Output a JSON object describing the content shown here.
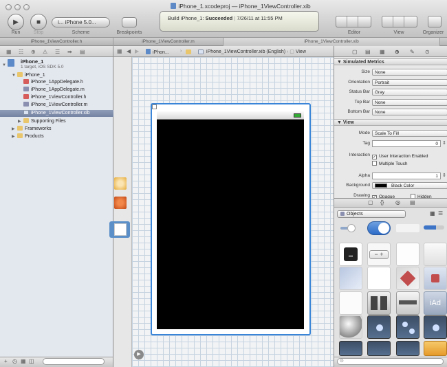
{
  "window": {
    "title": "iPhone_1.xcodeproj — iPhone_1ViewController.xib"
  },
  "toolbar": {
    "run_label": "Run",
    "stop_label": "Stop",
    "scheme_label": "Scheme",
    "scheme_value": "i... iPhone 5.0...",
    "breakpoints_label": "Breakpoints",
    "editor_label": "Editor",
    "view_label": "View",
    "organizer_label": "Organizer"
  },
  "activity": {
    "prefix": "Build iPhone_1: ",
    "status": "Succeeded",
    "timestamp": "7/26/11 at 11:55 PM"
  },
  "tabs": [
    {
      "label": "iPhone_1ViewController.h"
    },
    {
      "label": "iPhone_1ViewController.m"
    },
    {
      "label": "iPhone_1ViewController.xib"
    }
  ],
  "jumpbar": {
    "crumb_1": "iPhon...",
    "crumb_file": "iPhone_1ViewController.xib (English)",
    "crumb_view": "View"
  },
  "navigator": {
    "project_name": "iPhone_1",
    "project_sub": "1 target, iOS SDK 5.0",
    "items": [
      {
        "label": "iPhone_1",
        "kind": "fold"
      },
      {
        "label": "iPhone_1AppDelegate.h",
        "kind": "h"
      },
      {
        "label": "iPhone_1AppDelegate.m",
        "kind": "m"
      },
      {
        "label": "iPhone_1ViewController.h",
        "kind": "h"
      },
      {
        "label": "iPhone_1ViewController.m",
        "kind": "m"
      },
      {
        "label": "iPhone_1ViewController.xib",
        "kind": "x"
      },
      {
        "label": "Supporting Files",
        "kind": "fold"
      },
      {
        "label": "Frameworks",
        "kind": "fold"
      },
      {
        "label": "Products",
        "kind": "fold"
      }
    ]
  },
  "inspector": {
    "simulated_metrics_header": "Simulated Metrics",
    "size_label": "Size",
    "size_value": "None",
    "orientation_label": "Orientation",
    "orientation_value": "Portrait",
    "status_bar_label": "Status Bar",
    "status_bar_value": "Gray",
    "top_bar_label": "Top Bar",
    "top_bar_value": "None",
    "bottom_bar_label": "Bottom Bar",
    "bottom_bar_value": "None",
    "view_header": "View",
    "mode_label": "Mode",
    "mode_value": "Scale To Fill",
    "tag_label": "Tag",
    "tag_value": "0",
    "interaction_label": "Interaction",
    "user_interaction_label": "User Interaction Enabled",
    "multiple_touch_label": "Multiple Touch",
    "alpha_label": "Alpha",
    "alpha_value": "1",
    "background_label": "Background",
    "background_value": "Black Color",
    "drawing_label": "Drawing",
    "opaque_label": "Opaque",
    "hidden_label": "Hidden"
  },
  "library": {
    "objects_label": "Objects",
    "ibuttons_text": "iAd"
  },
  "colors": {
    "selection_blue": "#3a85d8",
    "screen_black": "#000000",
    "navigator_bg": "#e3e7ee"
  }
}
